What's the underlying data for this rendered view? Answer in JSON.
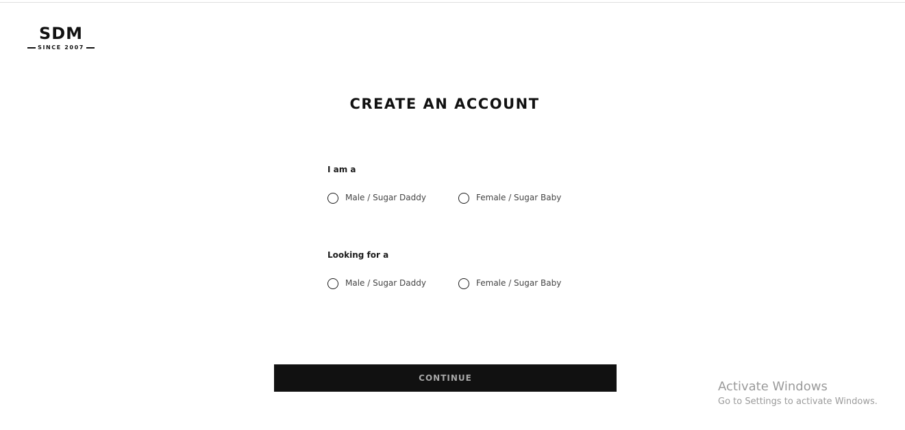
{
  "logo": {
    "title": "SDM",
    "subtitle": "SINCE 2007"
  },
  "page": {
    "title": "CREATE AN ACCOUNT"
  },
  "form": {
    "i_am": {
      "label": "I am a",
      "options": [
        {
          "label": "Male / Sugar Daddy",
          "checked": false
        },
        {
          "label": "Female / Sugar Baby",
          "checked": false
        }
      ]
    },
    "looking_for": {
      "label": "Looking for a",
      "options": [
        {
          "label": "Male / Sugar Daddy",
          "checked": false
        },
        {
          "label": "Female / Sugar Baby",
          "checked": false
        }
      ]
    },
    "continue_label": "CONTINUE"
  },
  "watermark": {
    "title": "Activate Windows",
    "subtitle": "Go to Settings to activate Windows."
  },
  "colors": {
    "text": "#1a1a1a",
    "button_bg": "#111111",
    "button_text": "#a8a8a8",
    "option_text": "#444444",
    "watermark": "#9a9a9a"
  }
}
